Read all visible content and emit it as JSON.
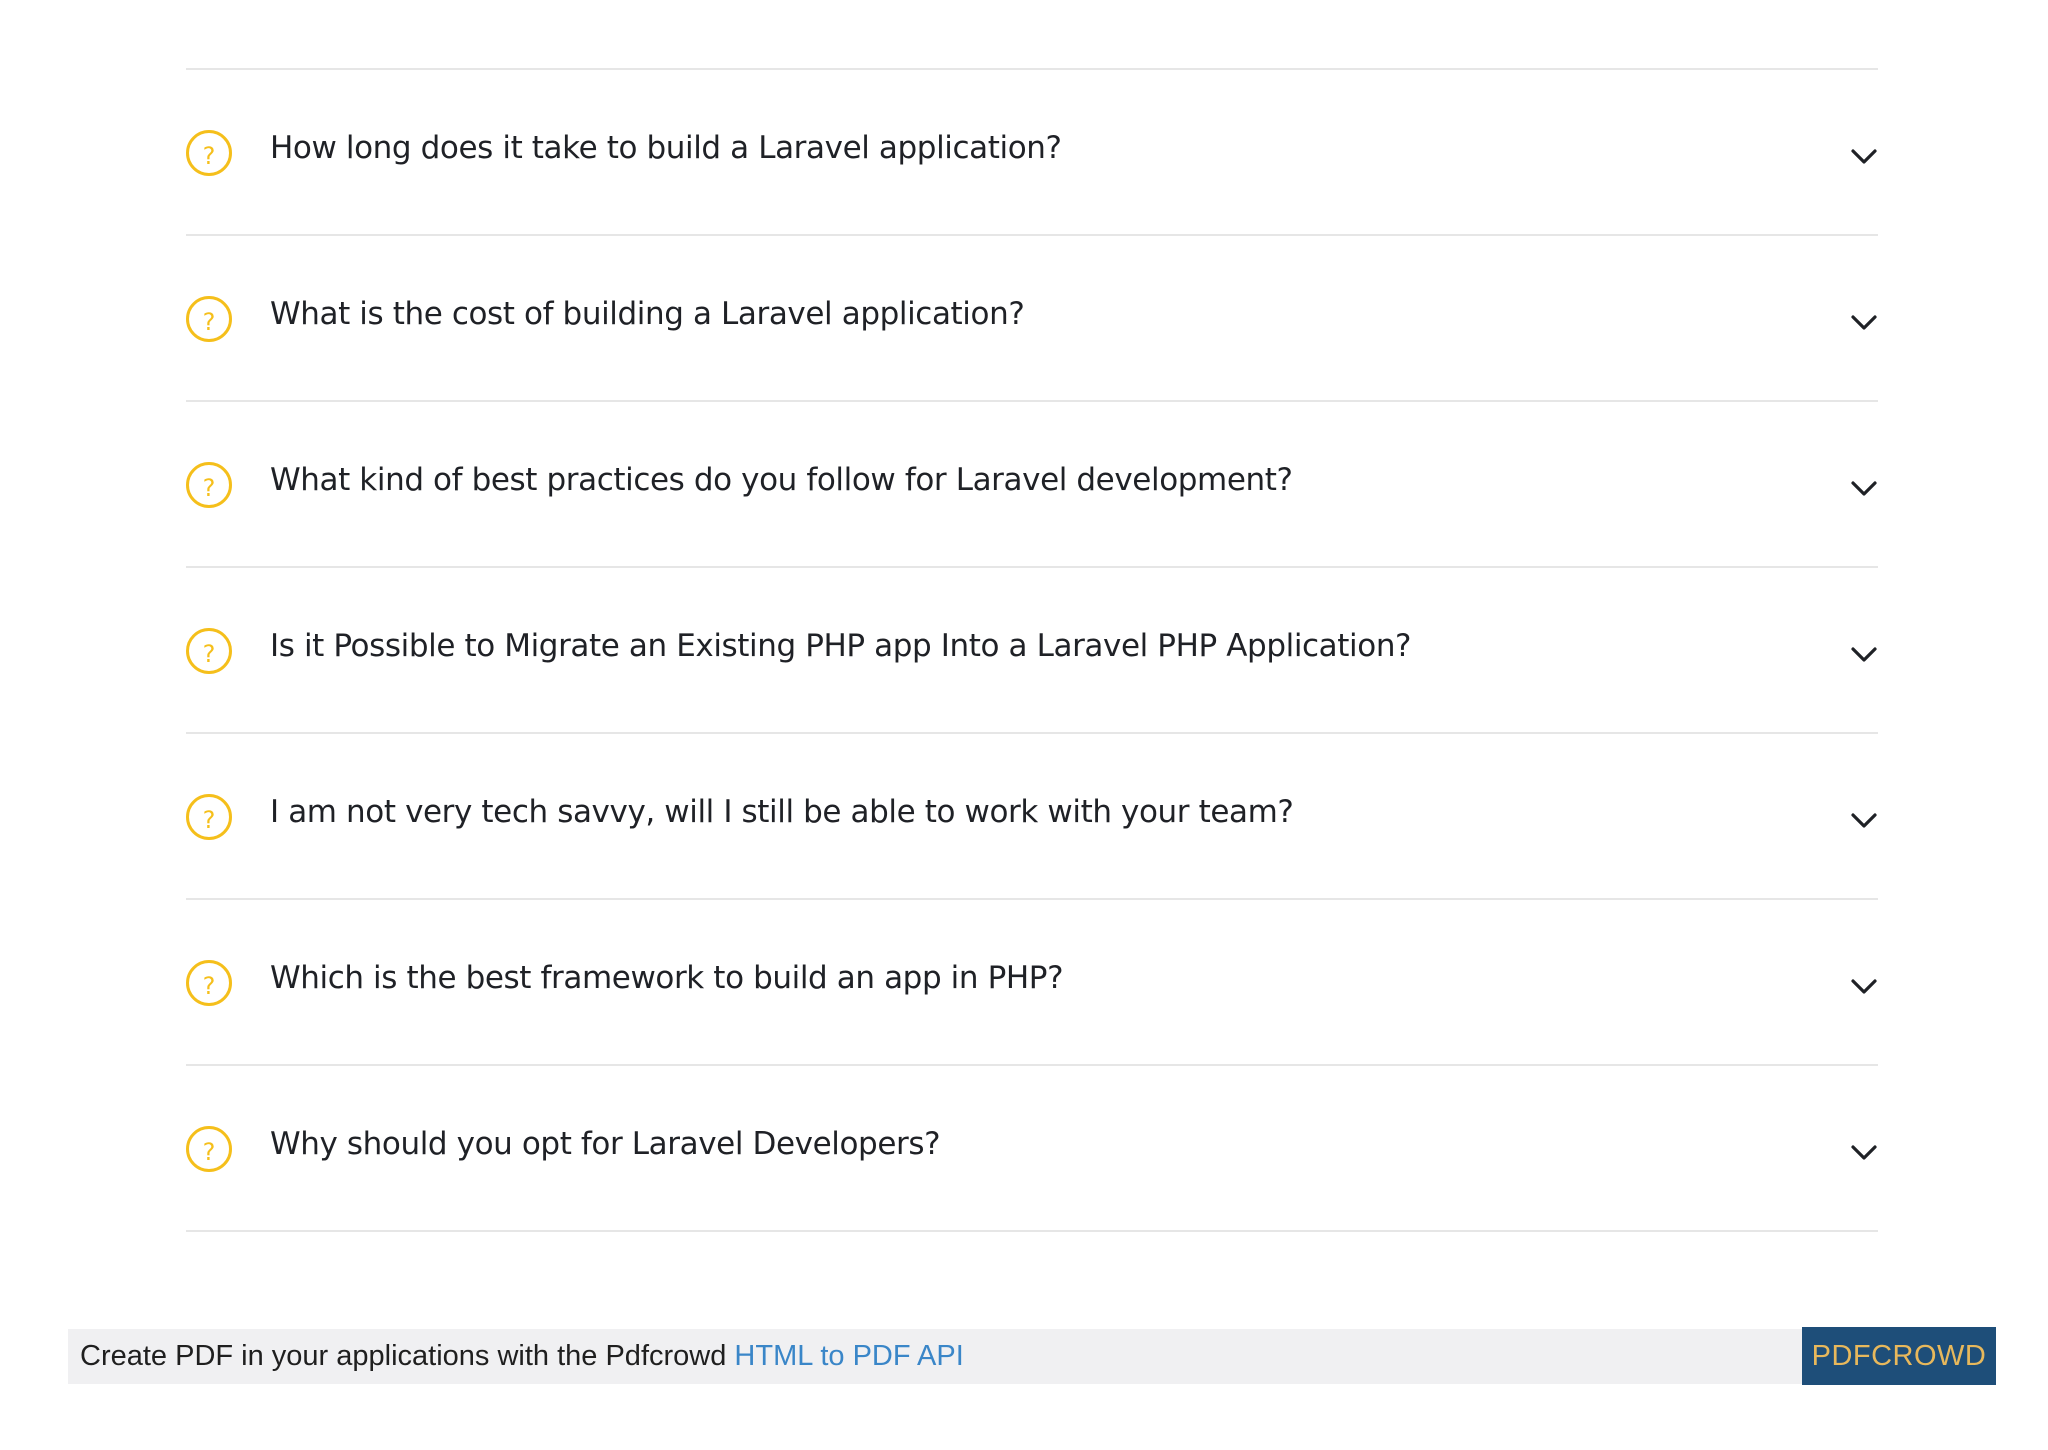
{
  "faq": {
    "items": [
      {
        "icon": "question-circle-icon",
        "question": "How long does it take to build a Laravel application?"
      },
      {
        "icon": "question-circle-icon",
        "question": "What is the cost of building a Laravel application?"
      },
      {
        "icon": "question-circle-icon",
        "question": "What kind of best practices do you follow for Laravel development?"
      },
      {
        "icon": "question-circle-icon",
        "question": "Is it Possible to Migrate an Existing PHP app Into a Laravel PHP Application?"
      },
      {
        "icon": "question-circle-icon",
        "question": "I am not very tech savvy, will I still be able to work with your team?"
      },
      {
        "icon": "question-circle-icon",
        "question": "Which is the best framework to build an app in PHP?"
      },
      {
        "icon": "question-circle-icon",
        "question": "Why should you opt for Laravel Developers?"
      }
    ],
    "icon_glyph": "?",
    "chevron_icon": "chevron-down-icon"
  },
  "footer": {
    "text": "Create PDF in your applications with the Pdfcrowd ",
    "link_text": "HTML to PDF API",
    "brand": "PDFCROWD"
  },
  "colors": {
    "accent_yellow": "#f5bf1b",
    "link_blue": "#3a86c8",
    "brand_bg": "#1e4e79",
    "brand_text": "#e7b85c"
  }
}
